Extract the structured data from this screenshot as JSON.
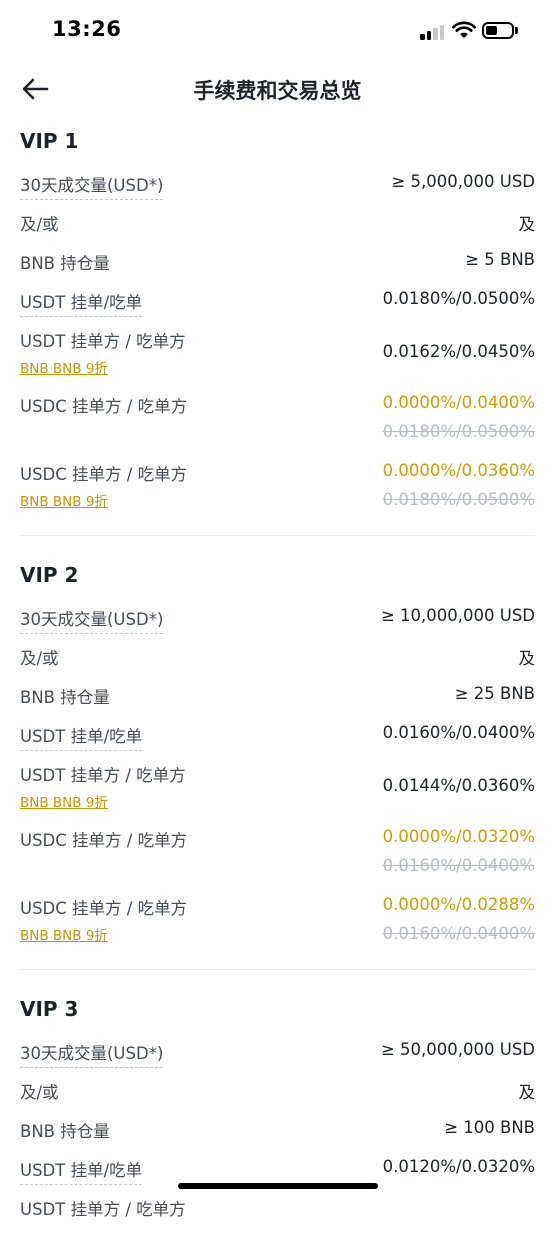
{
  "status": {
    "time": "13:26"
  },
  "header": {
    "title": "手续费和交易总览"
  },
  "tiers": [
    {
      "name": "VIP 1",
      "volume_label": "30天成交量(USD*)",
      "volume_value": "≥ 5,000,000 USD",
      "andor_label": "及/或",
      "andor_value": "及",
      "bnb_label": "BNB 持仓量",
      "bnb_value": "≥ 5 BNB",
      "usdt_label": "USDT 挂单/吃单",
      "usdt_value": "0.0180%/0.0500%",
      "usdt_bnb_label": "USDT 挂单方 / 吃单方",
      "usdt_bnb_sub": "BNB BNB 9折",
      "usdt_bnb_value": "0.0162%/0.0450%",
      "usdc_label": "USDC 挂单方 / 吃单方",
      "usdc_value": "0.0000%/0.0400%",
      "usdc_old": "0.0180%/0.0500%",
      "usdc_bnb_label": "USDC 挂单方 / 吃单方",
      "usdc_bnb_sub": "BNB BNB 9折",
      "usdc_bnb_value": "0.0000%/0.0360%",
      "usdc_bnb_old": "0.0180%/0.0500%"
    },
    {
      "name": "VIP 2",
      "volume_label": "30天成交量(USD*)",
      "volume_value": "≥ 10,000,000 USD",
      "andor_label": "及/或",
      "andor_value": "及",
      "bnb_label": "BNB 持仓量",
      "bnb_value": "≥ 25 BNB",
      "usdt_label": "USDT 挂单/吃单",
      "usdt_value": "0.0160%/0.0400%",
      "usdt_bnb_label": "USDT 挂单方 / 吃单方",
      "usdt_bnb_sub": "BNB BNB 9折",
      "usdt_bnb_value": "0.0144%/0.0360%",
      "usdc_label": "USDC 挂单方 / 吃单方",
      "usdc_value": "0.0000%/0.0320%",
      "usdc_old": "0.0160%/0.0400%",
      "usdc_bnb_label": "USDC 挂单方 / 吃单方",
      "usdc_bnb_sub": "BNB BNB 9折",
      "usdc_bnb_value": "0.0000%/0.0288%",
      "usdc_bnb_old": "0.0160%/0.0400%"
    },
    {
      "name": "VIP 3",
      "volume_label": "30天成交量(USD*)",
      "volume_value": "≥ 50,000,000 USD",
      "andor_label": "及/或",
      "andor_value": "及",
      "bnb_label": "BNB 持仓量",
      "bnb_value": "≥ 100 BNB",
      "usdt_label": "USDT 挂单/吃单",
      "usdt_value": "0.0120%/0.0320%",
      "usdt_bnb_label": "USDT 挂单方 / 吃单方"
    }
  ],
  "colors": {
    "accent_gold": "#d19d00",
    "text_primary": "#1e2329",
    "text_secondary": "#474d57",
    "strike_gray": "#b7bdc6"
  }
}
